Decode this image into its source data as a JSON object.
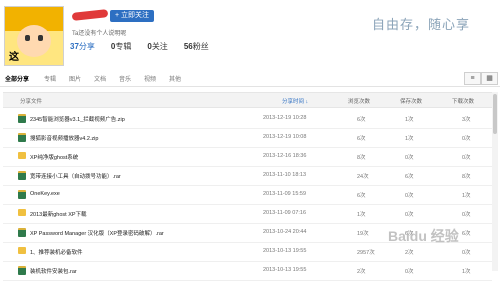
{
  "profile": {
    "avatar_caption": "这",
    "follow_label": "+ 立即关注",
    "bio": "Ta还没有个人说明呢",
    "stats": [
      {
        "num": "37",
        "label": "分享"
      },
      {
        "num": "0",
        "label": "专辑"
      },
      {
        "num": "0",
        "label": "关注"
      },
      {
        "num": "56",
        "label": "粉丝"
      }
    ],
    "slogan": "自由存，随心享"
  },
  "tabs": [
    "全部分享",
    "专辑",
    "图片",
    "文档",
    "音乐",
    "视频",
    "其他"
  ],
  "view_icons": [
    "≡",
    "▦"
  ],
  "table": {
    "headers": [
      "分享文件",
      "分享时间 ↓",
      "浏览次数",
      "保存次数",
      "下载次数"
    ],
    "rows": [
      {
        "icon": "file",
        "name": "2345智能浏览器v3.1_拦截视频广告.zip",
        "time": "2013-12-19 10:28",
        "views": "6次",
        "saves": "1次",
        "downs": "3次"
      },
      {
        "icon": "file",
        "name": "搜狐影音视频播放器v4.2.zip",
        "time": "2013-12-19 10:08",
        "views": "6次",
        "saves": "1次",
        "downs": "0次"
      },
      {
        "icon": "folder",
        "name": "XP纯净版ghost系统",
        "time": "2013-12-16 18:36",
        "views": "8次",
        "saves": "0次",
        "downs": "0次"
      },
      {
        "icon": "file",
        "name": "宽带连接小工具（自动拨号功能）.rar",
        "time": "2013-11-10 18:13",
        "views": "24次",
        "saves": "6次",
        "downs": "8次"
      },
      {
        "icon": "file",
        "name": "OneKey.exe",
        "time": "2013-11-09 15:59",
        "views": "6次",
        "saves": "0次",
        "downs": "1次"
      },
      {
        "icon": "folder",
        "name": "2013最新ghost XP下载",
        "time": "2013-11-09 07:16",
        "views": "1次",
        "saves": "0次",
        "downs": "0次"
      },
      {
        "icon": "file",
        "name": "XP Password Manager 汉化版（XP登录密码破解）.rar",
        "time": "2013-10-24 20:44",
        "views": "19次",
        "saves": "6次",
        "downs": "6次"
      },
      {
        "icon": "folder",
        "name": "1、推荐装机必备软件",
        "time": "2013-10-13 19:55",
        "views": "2957次",
        "saves": "2次",
        "downs": "0次"
      },
      {
        "icon": "file",
        "name": "装机软件安装包.rar",
        "time": "2013-10-13 19:55",
        "views": "2次",
        "saves": "0次",
        "downs": "1次"
      }
    ]
  },
  "watermark": "Baidu 经验",
  "colors": {
    "accent": "#2d6fc2",
    "header_bg": "#f3f3f3"
  }
}
